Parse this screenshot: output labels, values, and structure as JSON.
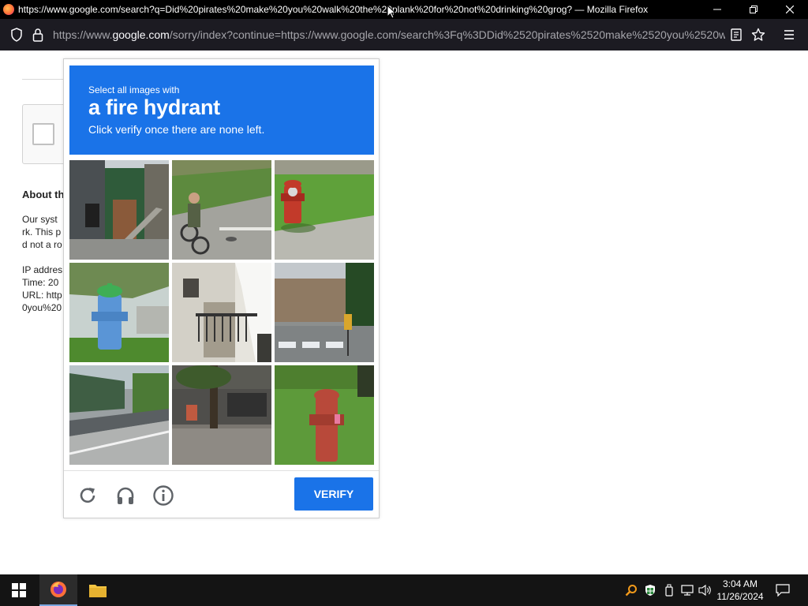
{
  "window": {
    "title": "https://www.google.com/search?q=Did%20pirates%20make%20you%20walk%20the%20plank%20for%20not%20drinking%20grog? — Mozilla Firefox",
    "minimize_icon": "minimize-icon",
    "restore_icon": "restore-icon",
    "close_icon": "close-icon"
  },
  "navbar": {
    "url_prefix": "https://www.",
    "url_domain": "google.com",
    "url_rest": "/sorry/index?continue=https://www.google.com/search%3Fq%3DDid%2520pirates%2520make%2520you%2520walk%2520the"
  },
  "page": {
    "heading": "About th",
    "lines": [
      "Our syst",
      "rk. This p",
      "d not a ro",
      "IP addres",
      "Time: 20",
      "URL: http",
      "0you%20"
    ]
  },
  "captcha": {
    "prompt_small": "Select all images with",
    "prompt_big": "a fire hydrant",
    "prompt_sub": "Click verify once there are none left.",
    "tiles": [
      {
        "label": "street building with stairs"
      },
      {
        "label": "person on bicycle"
      },
      {
        "label": "red fire hydrant on grass"
      },
      {
        "label": "blue fire hydrant"
      },
      {
        "label": "white building with balcony"
      },
      {
        "label": "city crosswalk"
      },
      {
        "label": "road with guardrail"
      },
      {
        "label": "storefront with tree"
      },
      {
        "label": "red fire hydrant in grass"
      }
    ],
    "verify_label": "VERIFY",
    "reload_icon": "reload-icon",
    "audio_icon": "headphones-icon",
    "info_icon": "info-icon"
  },
  "taskbar": {
    "time": "3:04 AM",
    "date": "11/26/2024"
  },
  "colors": {
    "accent": "#1a73e8",
    "titlebar": "#000000",
    "navbar": "#1c1b22",
    "taskbar": "#141414"
  }
}
